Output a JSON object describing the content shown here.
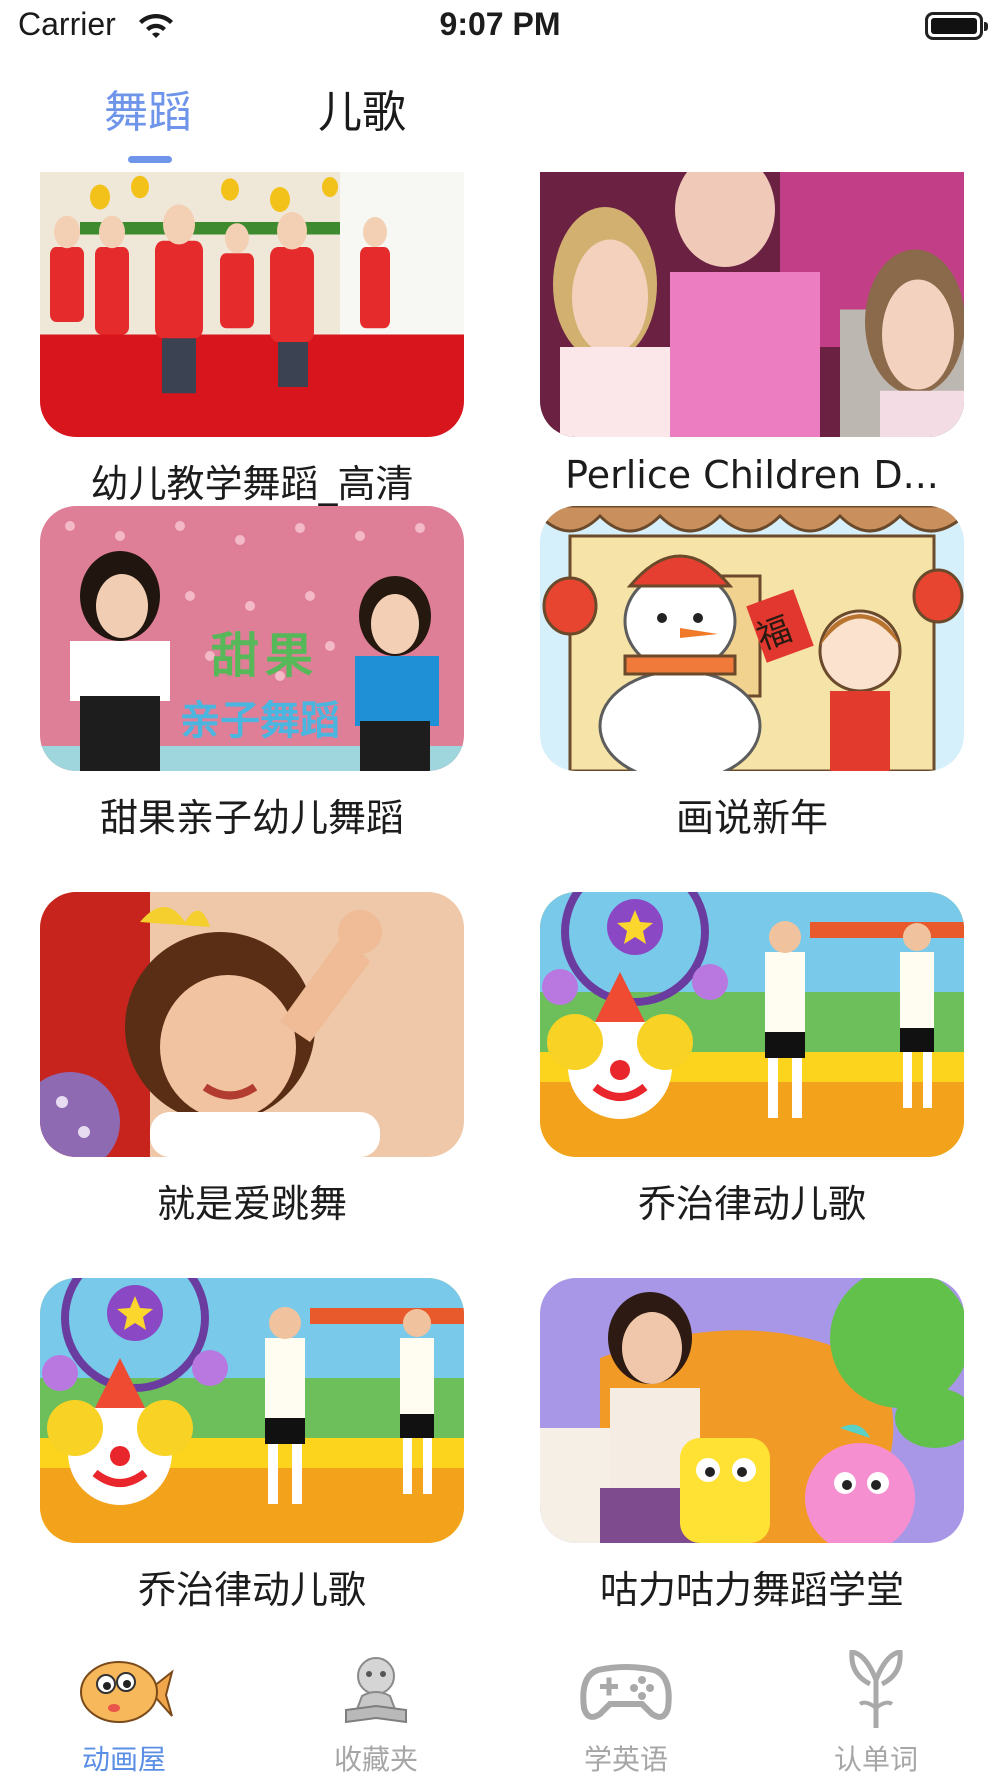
{
  "status": {
    "carrier": "Carrier",
    "time": "9:07 PM"
  },
  "tabs": [
    {
      "label": "舞蹈",
      "active": true
    },
    {
      "label": "儿歌",
      "active": false
    }
  ],
  "videos": [
    {
      "title": "幼儿教学舞蹈_高清"
    },
    {
      "title": "Perlice Children D..."
    },
    {
      "title": "甜果亲子幼儿舞蹈",
      "overlay_lines": [
        "甜果",
        "亲子舞蹈"
      ]
    },
    {
      "title": "画说新年",
      "overlay_char": "福"
    },
    {
      "title": "就是爱跳舞"
    },
    {
      "title": "乔治律动儿歌"
    },
    {
      "title": "乔治律动儿歌"
    },
    {
      "title": "咕力咕力舞蹈学堂"
    }
  ],
  "tabbar": [
    {
      "label": "动画屋",
      "icon": "fish-icon",
      "active": true
    },
    {
      "label": "收藏夹",
      "icon": "reading-child-icon",
      "active": false
    },
    {
      "label": "学英语",
      "icon": "gamepad-icon",
      "active": false
    },
    {
      "label": "认单词",
      "icon": "sprout-icon",
      "active": false
    }
  ],
  "colors": {
    "accent": "#6f95ea",
    "inactive": "#a6a6a6"
  }
}
